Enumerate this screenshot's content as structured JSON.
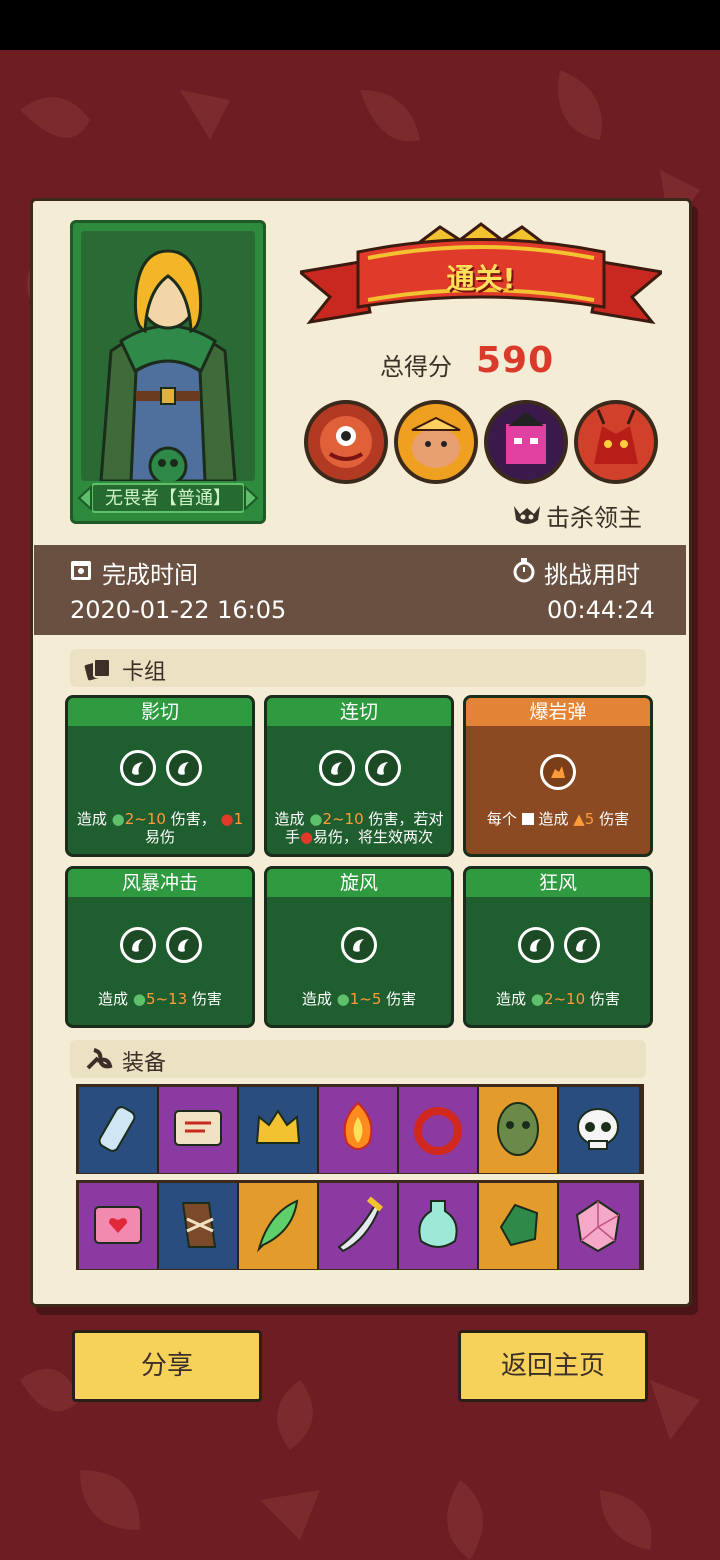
{
  "result": {
    "banner": "通关!",
    "score_label": "总得分",
    "score_value": "590",
    "kill_label": "击杀领主"
  },
  "hero": {
    "name": "无畏者【普通】"
  },
  "time": {
    "complete_label": "完成时间",
    "complete_value": "2020-01-22 16:05",
    "challenge_label": "挑战用时",
    "challenge_value": "00:44:24"
  },
  "deck": {
    "title": "卡组",
    "cards": [
      {
        "name": "影切",
        "color": "green",
        "orbs": 2,
        "desc": [
          "造成",
          "2~10",
          "伤害，",
          "1",
          "易伤"
        ]
      },
      {
        "name": "连切",
        "color": "green",
        "orbs": 2,
        "desc": [
          "造成",
          "2~10",
          "伤害，若对手",
          "易伤，将生效两次"
        ]
      },
      {
        "name": "爆岩弹",
        "color": "orange",
        "orbs": 1,
        "desc": [
          "每个",
          "造成",
          "5",
          "伤害"
        ]
      },
      {
        "name": "风暴冲击",
        "color": "green",
        "orbs": 2,
        "desc": [
          "造成",
          "5~13",
          "伤害"
        ]
      },
      {
        "name": "旋风",
        "color": "green",
        "orbs": 1,
        "desc": [
          "造成",
          "1~5",
          "伤害"
        ]
      },
      {
        "name": "狂风",
        "color": "green",
        "orbs": 2,
        "desc": [
          "造成",
          "2~10",
          "伤害"
        ]
      }
    ]
  },
  "equipment": {
    "title": "装备",
    "row1": [
      {
        "icon": "bandage-icon",
        "bg": "blue"
      },
      {
        "icon": "scroll-icon",
        "bg": "purple"
      },
      {
        "icon": "crown-helmet-icon",
        "bg": "blue"
      },
      {
        "icon": "fire-sword-icon",
        "bg": "purple"
      },
      {
        "icon": "red-ring-icon",
        "bg": "purple"
      },
      {
        "icon": "green-mask-icon",
        "bg": "orange"
      },
      {
        "icon": "skull-icon",
        "bg": "blue"
      }
    ],
    "row2": [
      {
        "icon": "heart-box-icon",
        "bg": "purple"
      },
      {
        "icon": "bracer-icon",
        "bg": "blue"
      },
      {
        "icon": "feather-icon",
        "bg": "orange"
      },
      {
        "icon": "dagger-icon",
        "bg": "purple"
      },
      {
        "icon": "potion-vase-icon",
        "bg": "purple"
      },
      {
        "icon": "green-gem-icon",
        "bg": "orange"
      },
      {
        "icon": "dice-icon",
        "bg": "purple"
      }
    ]
  },
  "buttons": {
    "share": "分享",
    "home": "返回主页"
  },
  "colors": {
    "background": "#6e1e22",
    "panel": "#f4ecd5",
    "score": "#d93a2a",
    "banner_red": "#c8281f",
    "card_green": "#1f5e2e",
    "card_orange": "#8b4a22",
    "button_yellow": "#f6d25b"
  }
}
